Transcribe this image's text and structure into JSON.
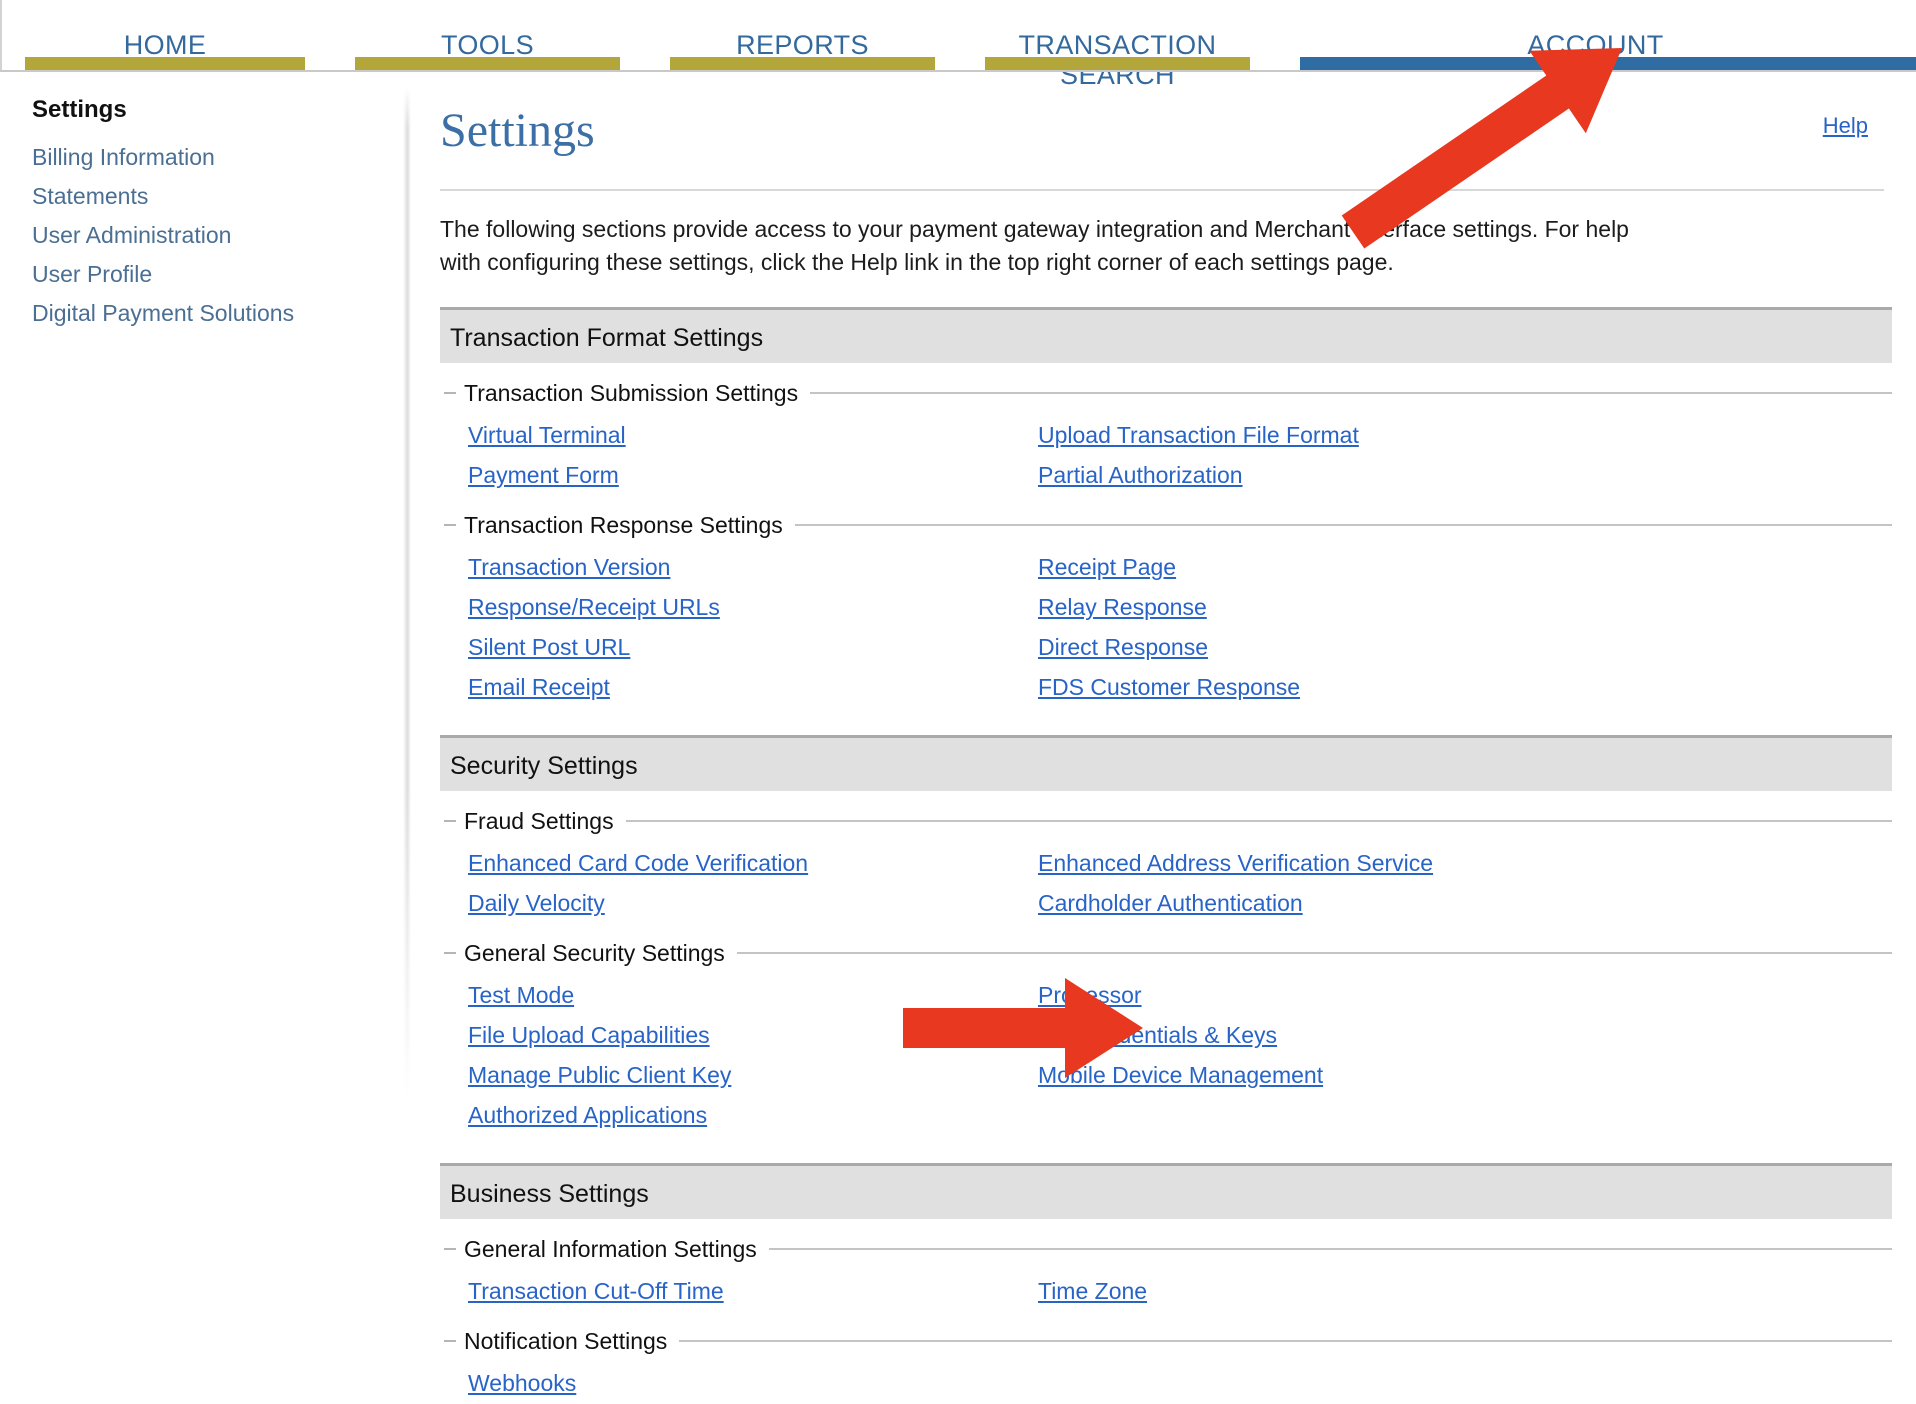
{
  "nav": {
    "tabs": [
      {
        "label": "HOME",
        "active": false
      },
      {
        "label": "TOOLS",
        "active": false
      },
      {
        "label": "REPORTS",
        "active": false
      },
      {
        "label": "TRANSACTION SEARCH",
        "active": false
      },
      {
        "label": "ACCOUNT",
        "active": true
      }
    ]
  },
  "sidebar": {
    "title": "Settings",
    "items": [
      {
        "label": "Billing Information"
      },
      {
        "label": "Statements"
      },
      {
        "label": "User Administration"
      },
      {
        "label": "User Profile"
      },
      {
        "label": "Digital Payment Solutions"
      }
    ]
  },
  "main": {
    "page_title": "Settings",
    "help_label": "Help",
    "intro": "The following sections provide access to your payment gateway integration and Merchant Interface settings. For help with configuring these settings, click the Help link in the top right corner of each settings page.",
    "sections": [
      {
        "header": "Transaction Format Settings",
        "groups": [
          {
            "legend": "Transaction Submission Settings",
            "links": [
              "Virtual Terminal",
              "Upload Transaction File Format",
              "Payment Form",
              "Partial Authorization"
            ]
          },
          {
            "legend": "Transaction Response Settings",
            "links": [
              "Transaction Version",
              "Receipt Page",
              "Response/Receipt URLs",
              "Relay Response",
              "Silent Post URL",
              "Direct Response",
              "Email Receipt",
              "FDS Customer Response"
            ]
          }
        ]
      },
      {
        "header": "Security Settings",
        "groups": [
          {
            "legend": "Fraud Settings",
            "links": [
              "Enhanced Card Code Verification",
              "Enhanced Address Verification Service",
              "Daily Velocity",
              "Cardholder Authentication"
            ]
          },
          {
            "legend": "General Security Settings",
            "links": [
              "Test Mode",
              "Processor",
              "File Upload Capabilities",
              "API Credentials & Keys",
              "Manage Public Client Key",
              "Mobile Device Management",
              "Authorized Applications",
              ""
            ]
          }
        ]
      },
      {
        "header": "Business Settings",
        "groups": [
          {
            "legend": "General Information Settings",
            "links": [
              "Transaction Cut-Off Time",
              "Time Zone"
            ]
          },
          {
            "legend": "Notification Settings",
            "links": [
              "Webhooks",
              ""
            ]
          }
        ]
      }
    ]
  },
  "annotations": {
    "color": "#E8381F",
    "arrows": [
      {
        "name": "arrow-to-account-tab",
        "from": [
          1353,
          232
        ],
        "to": [
          1622,
          48
        ]
      },
      {
        "name": "arrow-to-api-credentials",
        "from": [
          903,
          1028
        ],
        "to": [
          1143,
          1028
        ]
      }
    ]
  },
  "colors": {
    "link": "#2864c8",
    "nav_label": "#33699c",
    "nav_underline": "#b3a63a",
    "nav_underline_active": "#2e6ca3",
    "section_header_bg": "#e0e0e0",
    "title": "#3c6fa5",
    "sidebar_link": "#4a6f93"
  }
}
